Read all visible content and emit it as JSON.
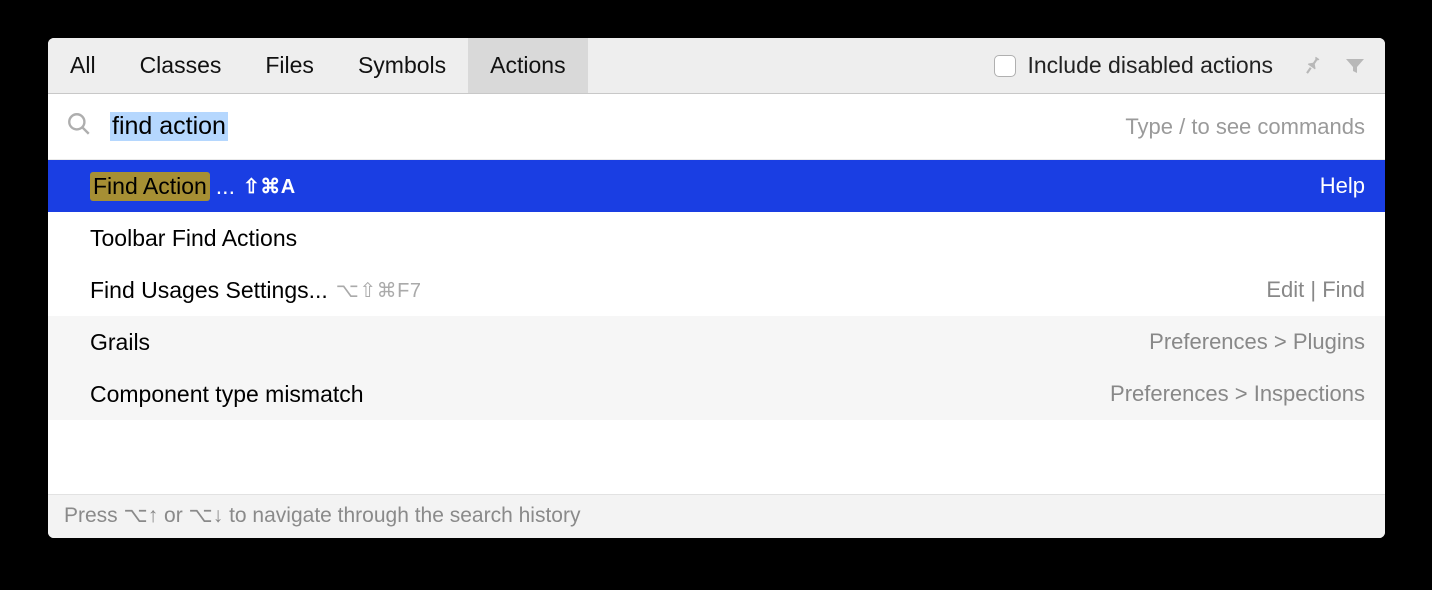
{
  "tabs": {
    "all": "All",
    "classes": "Classes",
    "files": "Files",
    "symbols": "Symbols",
    "actions": "Actions"
  },
  "active_tab": "actions",
  "include_disabled": {
    "label": "Include disabled actions",
    "checked": false
  },
  "search": {
    "value": "find action",
    "hint": "Type / to see commands"
  },
  "results": [
    {
      "id": "find-action",
      "highlight": "Find Action",
      "suffix": "...",
      "shortcut": "⇧⌘A",
      "location": "Help",
      "selected": true,
      "alt": false
    },
    {
      "id": "toolbar-find-actions",
      "label": "Toolbar Find Actions",
      "location": "",
      "selected": false,
      "alt": false
    },
    {
      "id": "find-usages-settings",
      "label": "Find Usages Settings...",
      "shortcut": "⌥⇧⌘F7",
      "shortcut_dim": true,
      "location": "Edit | Find",
      "selected": false,
      "alt": false
    },
    {
      "id": "grails",
      "label": "Grails",
      "location": "Preferences > Plugins",
      "selected": false,
      "alt": true
    },
    {
      "id": "component-type-mismatch",
      "label": "Component type mismatch",
      "location": "Preferences > Inspections",
      "selected": false,
      "alt": true
    }
  ],
  "footer": "Press ⌥↑ or ⌥↓ to navigate through the search history"
}
